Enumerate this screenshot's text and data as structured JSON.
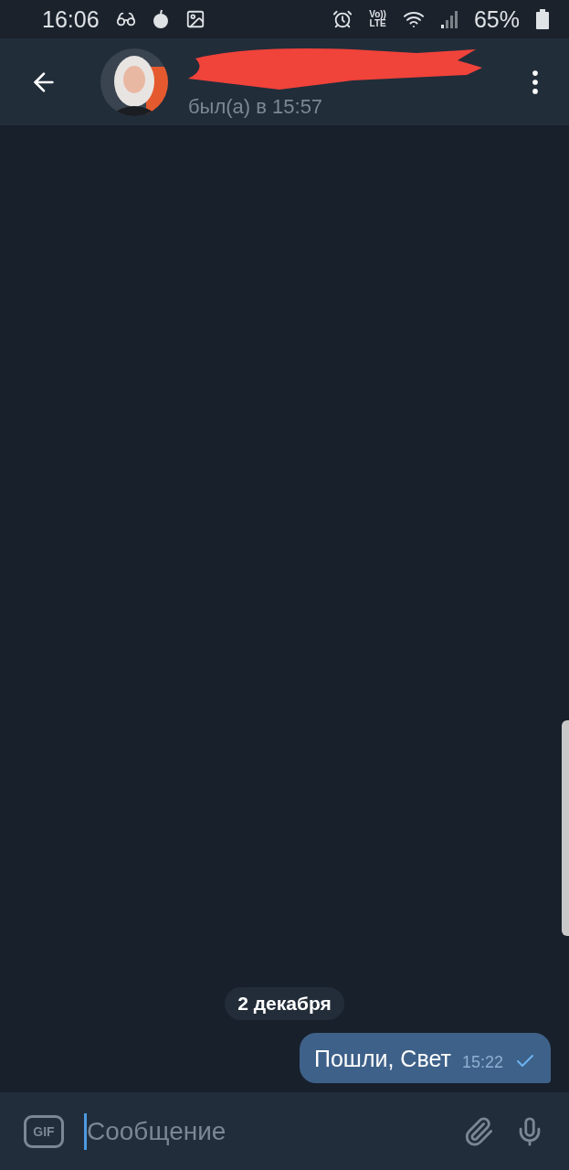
{
  "status_bar": {
    "time": "16:06",
    "network": "Vo))\nLTE",
    "battery": "65%"
  },
  "header": {
    "status": "был(а) в 15:57"
  },
  "messages": [
    {
      "kind": "date",
      "text": "2 декабря"
    },
    {
      "kind": "outgoing",
      "text": "Пошли, Свет",
      "time": "15:22",
      "read": false
    }
  ],
  "composer": {
    "gif": "GIF",
    "placeholder": "Сообщение"
  }
}
